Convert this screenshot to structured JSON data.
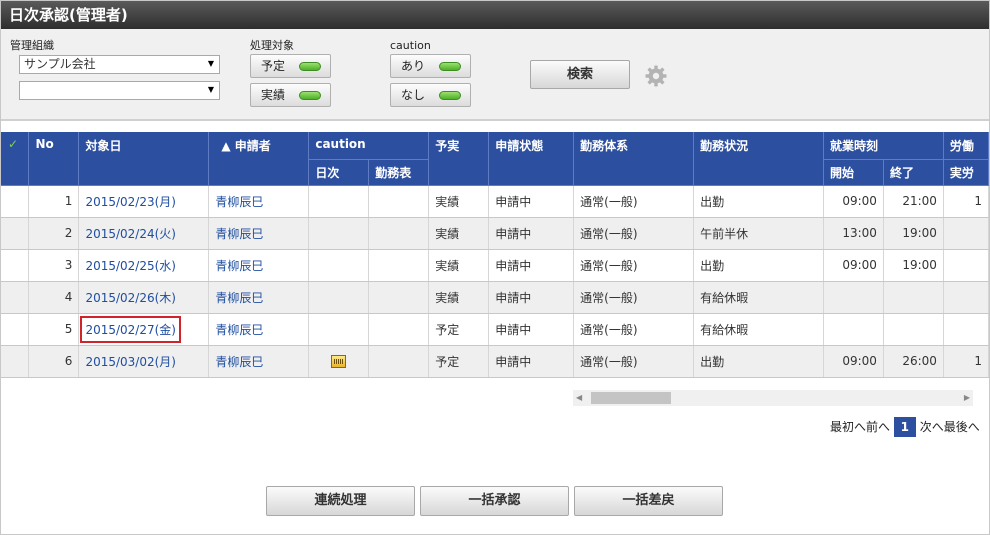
{
  "window": {
    "title": "日次承認(管理者)"
  },
  "filter": {
    "org_label": "管理組織",
    "org_select_1": "サンプル会社",
    "org_select_2": "",
    "target_label": "処理対象",
    "target_plan": "予定",
    "target_actual": "実績",
    "caution_label": "caution",
    "caution_yes": "あり",
    "caution_no": "なし",
    "search_label": "検索"
  },
  "table": {
    "headers": {
      "check": "✓",
      "no": "No",
      "date": "対象日",
      "applicant": "▲ 申請者",
      "caution": "caution",
      "caution_daily": "日次",
      "caution_sheet": "勤務表",
      "plan_actual": "予実",
      "status": "申請状態",
      "system": "勤務体系",
      "work_status": "勤務状況",
      "work_time": "就業時刻",
      "start": "開始",
      "end": "終了",
      "labor": "労働",
      "labor_actual": "実労"
    },
    "rows": [
      {
        "no": "1",
        "date": "2015/02/23(月)",
        "applicant": "青柳辰巳",
        "daily": "",
        "sheet": "",
        "plan_actual": "実績",
        "status": "申請中",
        "system": "通常(一般)",
        "work_status": "出勤",
        "start": "09:00",
        "end": "21:00",
        "labor": "1"
      },
      {
        "no": "2",
        "date": "2015/02/24(火)",
        "applicant": "青柳辰巳",
        "daily": "",
        "sheet": "",
        "plan_actual": "実績",
        "status": "申請中",
        "system": "通常(一般)",
        "work_status": "午前半休",
        "start": "13:00",
        "end": "19:00",
        "labor": ""
      },
      {
        "no": "3",
        "date": "2015/02/25(水)",
        "applicant": "青柳辰巳",
        "daily": "",
        "sheet": "",
        "plan_actual": "実績",
        "status": "申請中",
        "system": "通常(一般)",
        "work_status": "出勤",
        "start": "09:00",
        "end": "19:00",
        "labor": ""
      },
      {
        "no": "4",
        "date": "2015/02/26(木)",
        "applicant": "青柳辰巳",
        "daily": "",
        "sheet": "",
        "plan_actual": "実績",
        "status": "申請中",
        "system": "通常(一般)",
        "work_status": "有給休暇",
        "start": "",
        "end": "",
        "labor": ""
      },
      {
        "no": "5",
        "date": "2015/02/27(金)",
        "applicant": "青柳辰巳",
        "daily": "",
        "sheet": "",
        "plan_actual": "予定",
        "status": "申請中",
        "system": "通常(一般)",
        "work_status": "有給休暇",
        "start": "",
        "end": "",
        "labor": ""
      },
      {
        "no": "6",
        "date": "2015/03/02(月)",
        "applicant": "青柳辰巳",
        "daily": "caution-icon",
        "sheet": "",
        "plan_actual": "予定",
        "status": "申請中",
        "system": "通常(一般)",
        "work_status": "出勤",
        "start": "09:00",
        "end": "26:00",
        "labor": "1"
      }
    ]
  },
  "pager": {
    "first": "最初へ",
    "prev": "前へ",
    "current": "1",
    "next": "次へ",
    "last": "最後へ"
  },
  "actions": {
    "continuous": "連続処理",
    "bulk_approve": "一括承認",
    "bulk_return": "一括差戻"
  },
  "colors": {
    "header_bg": "#2c4fa0",
    "title_bg": "#3a3a3a",
    "led_green": "#4db028",
    "highlight_red": "#d0232a"
  }
}
